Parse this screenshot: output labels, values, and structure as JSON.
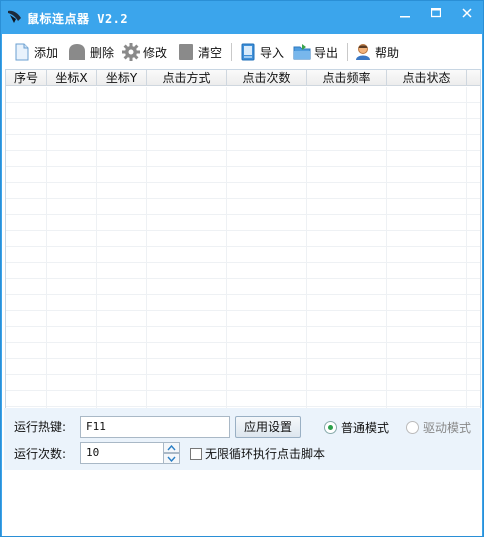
{
  "window": {
    "title": "鼠标连点器 V2.2",
    "controls": {
      "minimize": "—",
      "maximize": "☐",
      "close": "✕"
    }
  },
  "toolbar": {
    "items": [
      {
        "label": "添加",
        "icon": "document-add-icon"
      },
      {
        "label": "删除",
        "icon": "delete-icon"
      },
      {
        "label": "修改",
        "icon": "gear-icon"
      },
      {
        "label": "清空",
        "icon": "clear-icon"
      },
      {
        "label": "导入",
        "icon": "import-icon"
      },
      {
        "label": "导出",
        "icon": "folder-export-icon"
      },
      {
        "label": "帮助",
        "icon": "user-help-icon"
      }
    ]
  },
  "table": {
    "columns": [
      "序号",
      "坐标X",
      "坐标Y",
      "点击方式",
      "点击次数",
      "点击频率",
      "点击状态"
    ],
    "rows": []
  },
  "settings": {
    "hotkey_label": "运行热键:",
    "hotkey_value": "F11",
    "apply_button": "应用设置",
    "count_label": "运行次数:",
    "count_value": "10",
    "mode_normal": "普通模式",
    "mode_driver": "驱动模式",
    "selected_mode": "普通模式",
    "loop_label": "无限循环执行点击脚本",
    "loop_checked": false
  },
  "colors": {
    "titlebar": "#3ba5ec",
    "panel": "#ebf3fb",
    "radio_selected": "#2aa04a"
  }
}
